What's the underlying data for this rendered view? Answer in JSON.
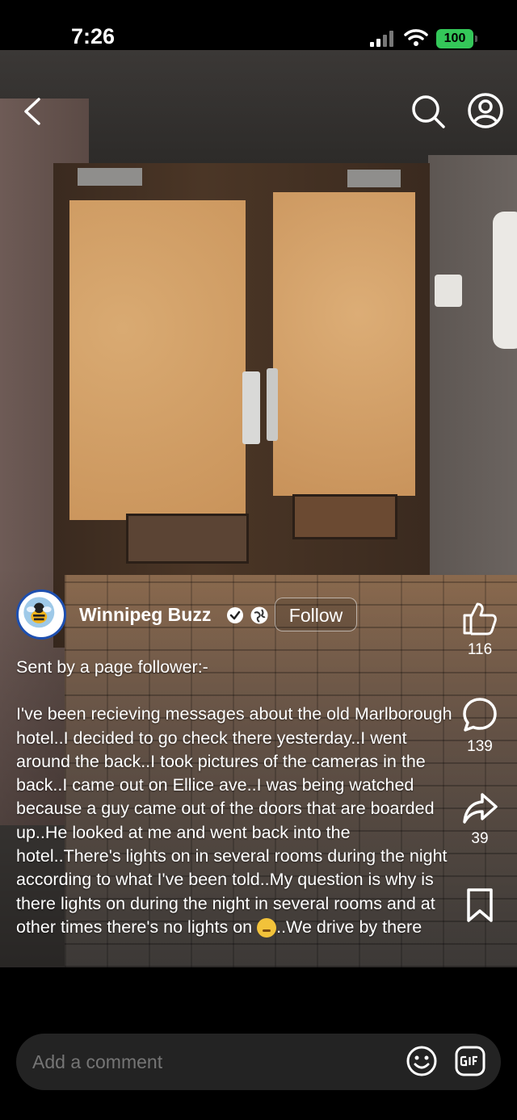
{
  "status_bar": {
    "time": "7:26",
    "battery": "100"
  },
  "header": {
    "back_icon": "chevron-left-icon",
    "search_icon": "search-icon",
    "profile_icon": "profile-icon"
  },
  "post": {
    "page_name": "Winnipeg Buzz",
    "follow_label": "Follow",
    "caption_intro": "Sent by a page follower:-",
    "caption_body": "I've been recieving messages about the old Marlborough hotel..I decided to go check there yesterday..I went around the back..I took pictures of the cameras in the back..I came out on Ellice ave..I was being watched because a guy came out of the doors that are boarded up..He looked at me and went back into the hotel..There's lights on in several rooms during the night according to what I've been told..My question is why is there lights on during the night in several rooms and at other times there's no lights on",
    "caption_tail": "..We drive by there"
  },
  "actions": {
    "likes": "116",
    "comments": "139",
    "shares": "39"
  },
  "comment_bar": {
    "placeholder": "Add a comment"
  },
  "colors": {
    "battery": "#34c759",
    "verified_badge": "#ffffff",
    "avatar_ring": "#1d4fb0"
  }
}
